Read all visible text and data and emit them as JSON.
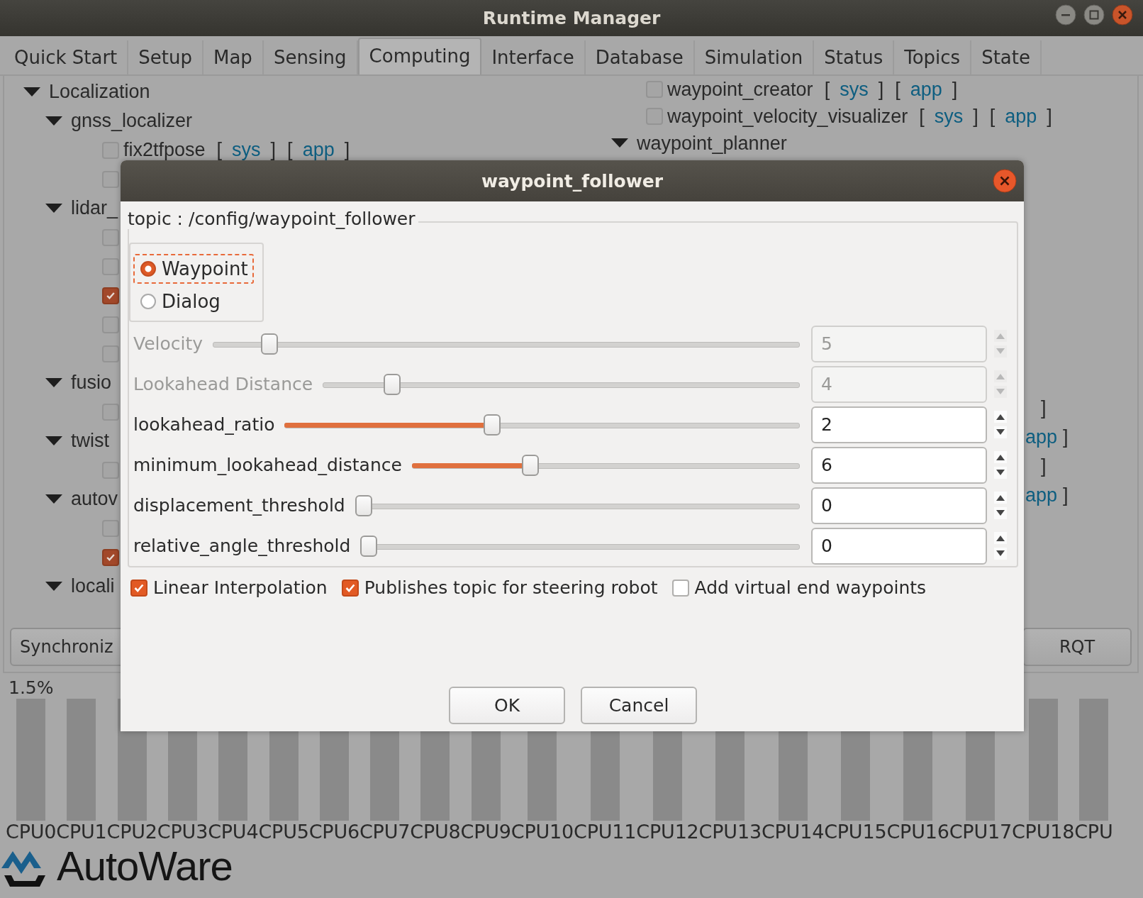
{
  "window": {
    "title": "Runtime Manager"
  },
  "tabs": [
    {
      "label": "Quick Start",
      "selected": false
    },
    {
      "label": "Setup",
      "selected": false
    },
    {
      "label": "Map",
      "selected": false
    },
    {
      "label": "Sensing",
      "selected": false
    },
    {
      "label": "Computing",
      "selected": true
    },
    {
      "label": "Interface",
      "selected": false
    },
    {
      "label": "Database",
      "selected": false
    },
    {
      "label": "Simulation",
      "selected": false
    },
    {
      "label": "Status",
      "selected": false
    },
    {
      "label": "Topics",
      "selected": false
    },
    {
      "label": "State",
      "selected": false
    }
  ],
  "left_tree": [
    {
      "kind": "group",
      "label": "Localization",
      "expanded": true,
      "children": [
        {
          "kind": "group",
          "label": "gnss_localizer",
          "expanded": true,
          "children": [
            {
              "kind": "item",
              "label": "fix2tfpose",
              "checked": false,
              "links": [
                {
                  "open": "[",
                  "label": "sys",
                  "close": "]"
                },
                {
                  "open": "[",
                  "label": "app",
                  "close": "]"
                }
              ]
            },
            {
              "kind": "item",
              "checked": false
            }
          ]
        },
        {
          "kind": "group",
          "label": "lidar_",
          "expanded": true,
          "children": [
            {
              "kind": "item",
              "checked": false
            },
            {
              "kind": "item",
              "checked": false
            },
            {
              "kind": "item",
              "checked": true
            },
            {
              "kind": "item",
              "checked": false
            },
            {
              "kind": "item",
              "checked": false
            }
          ]
        },
        {
          "kind": "group",
          "label": "fusio",
          "expanded": true,
          "children": [
            {
              "kind": "item",
              "checked": false
            }
          ]
        },
        {
          "kind": "group",
          "label": "twist",
          "expanded": true,
          "children": [
            {
              "kind": "item",
              "checked": false
            }
          ]
        },
        {
          "kind": "group",
          "label": "autov",
          "expanded": true,
          "children": [
            {
              "kind": "item",
              "checked": false
            },
            {
              "kind": "item",
              "checked": true
            }
          ]
        },
        {
          "kind": "group",
          "label": "locali",
          "expanded": true
        }
      ]
    }
  ],
  "right_tree": [
    {
      "kind": "item",
      "label": "waypoint_creator",
      "checked": false,
      "links": [
        {
          "open": "[",
          "label": "sys",
          "close": "]"
        },
        {
          "open": "[",
          "label": "app",
          "close": "]"
        }
      ]
    },
    {
      "kind": "item",
      "label": "waypoint_velocity_visualizer",
      "checked": false,
      "links": [
        {
          "open": "[",
          "label": "sys",
          "close": "]"
        },
        {
          "open": "[",
          "label": "app",
          "close": "]"
        }
      ]
    },
    {
      "kind": "group",
      "label": "waypoint_planner",
      "expanded": true
    }
  ],
  "row_tails": [
    {
      "close": "]"
    },
    {
      "link": "app",
      "close": "]"
    },
    {
      "close": "]"
    },
    {
      "link": "app",
      "close": "]"
    }
  ],
  "pane_buttons": [
    {
      "label": "Synchroniz"
    },
    {
      "label": "RQT"
    }
  ],
  "cpu": {
    "scale_label": "1.5%",
    "cores": [
      {
        "label": "CPU0"
      },
      {
        "label": "CPU1"
      },
      {
        "label": "CPU2"
      },
      {
        "label": "CPU3"
      },
      {
        "label": "CPU4"
      },
      {
        "label": "CPU5"
      },
      {
        "label": "CPU6"
      },
      {
        "label": "CPU7"
      },
      {
        "label": "CPU8"
      },
      {
        "label": "CPU9"
      },
      {
        "label": "CPU10"
      },
      {
        "label": "CPU11"
      },
      {
        "label": "CPU12"
      },
      {
        "label": "CPU13"
      },
      {
        "label": "CPU14"
      },
      {
        "label": "CPU15"
      },
      {
        "label": "CPU16"
      },
      {
        "label": "CPU17"
      },
      {
        "label": "CPU18"
      },
      {
        "label": "CPU"
      }
    ]
  },
  "logo": {
    "text": "AutoWare"
  },
  "dialog": {
    "title": "waypoint_follower",
    "group_title": "topic : /config/waypoint_follower",
    "modes": [
      {
        "label": "Waypoint",
        "selected": true,
        "focused": true
      },
      {
        "label": "Dialog",
        "selected": false,
        "focused": false
      }
    ],
    "params": [
      {
        "name": "Velocity",
        "disabled": true,
        "level": 0.085,
        "value": "5"
      },
      {
        "name": "Lookahead Distance",
        "disabled": true,
        "level": 0.133,
        "value": "4"
      },
      {
        "name": "lookahead_ratio",
        "disabled": false,
        "level": 0.4,
        "value": "2"
      },
      {
        "name": "minimum_lookahead_distance",
        "disabled": false,
        "level": 0.297,
        "value": "6"
      },
      {
        "name": "displacement_threshold",
        "disabled": false,
        "level": 0,
        "value": "0"
      },
      {
        "name": "relative_angle_threshold",
        "disabled": false,
        "level": 0,
        "value": "0"
      }
    ],
    "options": [
      {
        "label": "Linear Interpolation",
        "checked": true
      },
      {
        "label": "Publishes topic for steering robot",
        "checked": true
      },
      {
        "label": "Add virtual end waypoints",
        "checked": false
      }
    ],
    "buttons": [
      {
        "label": "OK"
      },
      {
        "label": "Cancel"
      }
    ]
  }
}
